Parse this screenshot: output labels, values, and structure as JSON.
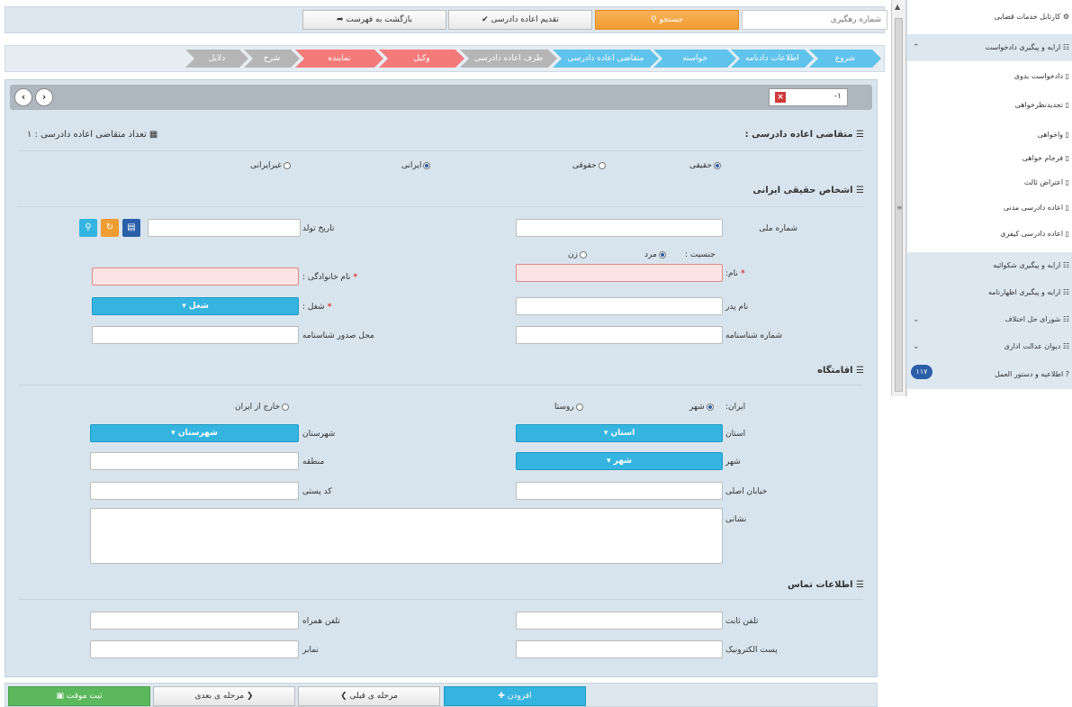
{
  "topbar": {
    "tracking_placeholder": "شماره رهگیری",
    "search_label": "جستجو",
    "submit_label": "تقدیم اعاده دادرسی",
    "back_label": "بازگشت به فهرست"
  },
  "steps": [
    {
      "label": "شروع"
    },
    {
      "label": "اطلاعات دادنامه"
    },
    {
      "label": "خواسته"
    },
    {
      "label": "متقاضی اعاده دادرسی"
    },
    {
      "label": "طرف اعاده دادرسی"
    },
    {
      "label": "وکیل"
    },
    {
      "label": "نماینده"
    },
    {
      "label": "شرح"
    },
    {
      "label": "دلایل"
    }
  ],
  "form": {
    "tab_number": "-۱",
    "prev_arrow": "‹",
    "next_arrow": "›",
    "applicant_title": "متقاضی اعاده دادرسی :",
    "applicant_count": "تعداد متقاضی اعاده دادرسی : ۱",
    "person_type_real": "حقیقی",
    "person_type_legal": "حقوقی",
    "nationality_iranian": "ایرانی",
    "nationality_foreign": "غیرایرانی",
    "iranian_persons_title": "اشخاص حقیقی ایرانی",
    "national_id_label": "شماره ملی",
    "birth_date_label": "تاریخ تولد",
    "gender_label": "جنسیت :",
    "gender_male": "مرد",
    "gender_female": "زن",
    "first_name_label": "نام:",
    "last_name_label": "نام خانوادگی :",
    "father_name_label": "نام پدر",
    "job_label": "شغل :",
    "job_dropdown": "شغل",
    "id_number_label": "شماره شناسنامه",
    "id_issue_place_label": "محل صدور شناسنامه",
    "residence_title": "اقامتگاه",
    "iran_label": "ایران:",
    "city_option": "شهر",
    "village_option": "روستا",
    "abroad_option": "خارج از ایران",
    "province_label": "استان",
    "province_dropdown": "استان",
    "county_label": "شهرستان",
    "county_dropdown": "شهرستان",
    "city_label": "شهر",
    "city_dropdown": "شهر",
    "district_label": "منطقه",
    "main_street_label": "خیابان اصلی",
    "postal_code_label": "کد پستی",
    "address_label": "نشانی",
    "contact_title": "اطلاعات تماس",
    "landline_label": "تلفن ثابت",
    "mobile_label": "تلفن همراه",
    "email_label": "پست الکترونیک",
    "fax_label": "نمابر"
  },
  "bottom": {
    "add_label": "افزودن",
    "prev_label": "مرحله ی قبلی",
    "next_label": "مرحله ی بعدی",
    "save_label": "ثبت موقت"
  },
  "sidebar": {
    "items": [
      {
        "label": "کارتابل خدمات قضایی"
      },
      {
        "label": "ارایه و پیگیری دادخواست"
      },
      {
        "label": "دادخواست بدوی"
      },
      {
        "label": "تجدیدنظرخواهی"
      },
      {
        "label": "واخواهی"
      },
      {
        "label": "فرجام خواهی"
      },
      {
        "label": "اعتراض ثالث"
      },
      {
        "label": "اعاده دادرسی مدنی"
      },
      {
        "label": "اعاده دادرسی کیفری"
      },
      {
        "label": "ارایه و پیگیری شکوائیه"
      },
      {
        "label": "ارایه و پیگیری اظهارنامه"
      },
      {
        "label": "شورای حل اختلاف"
      },
      {
        "label": "دیوان عدالت اداری"
      },
      {
        "label": "اطلاعیه و دستور العمل"
      }
    ],
    "badge": "۱۱۷"
  },
  "colors": {
    "accent": "#35b4e0",
    "search": "#ef9c31",
    "error": "#fce4e4",
    "save": "#5cb85c"
  }
}
